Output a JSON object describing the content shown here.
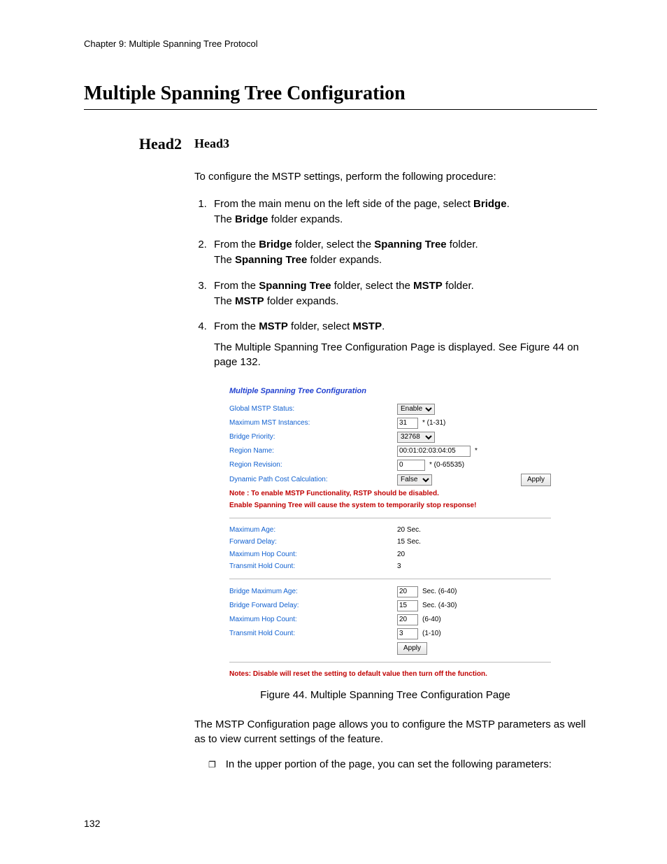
{
  "chapter_line": "Chapter 9: Multiple Spanning Tree Protocol",
  "h1": "Multiple Spanning Tree Configuration",
  "head2": "Head2",
  "head3": "Head3",
  "intro": "To configure the MSTP settings, perform the following procedure:",
  "steps": {
    "s1_a": "From the main menu on the left side of the page, select ",
    "s1_bold": "Bridge",
    "s1_b": ".",
    "s1_sub_a": "The ",
    "s1_sub_bold": "Bridge",
    "s1_sub_b": " folder expands.",
    "s2_a": "From the ",
    "s2_bold1": "Bridge",
    "s2_b": " folder, select the ",
    "s2_bold2": "Spanning Tree",
    "s2_c": " folder.",
    "s2_sub_a": "The ",
    "s2_sub_bold": "Spanning Tree",
    "s2_sub_b": " folder expands.",
    "s3_a": "From the ",
    "s3_bold1": "Spanning Tree",
    "s3_b": " folder, select the ",
    "s3_bold2": "MSTP",
    "s3_c": " folder.",
    "s3_sub_a": "The ",
    "s3_sub_bold": "MSTP",
    "s3_sub_b": " folder expands.",
    "s4_a": "From the ",
    "s4_bold1": "MSTP",
    "s4_b": " folder, select ",
    "s4_bold2": "MSTP",
    "s4_c": ".",
    "s4_note": "The Multiple Spanning Tree Configuration Page is displayed. See Figure 44 on page 132."
  },
  "ui": {
    "title": "Multiple Spanning Tree Configuration",
    "row1_label": "Global MSTP Status:",
    "row1_value": "Enable",
    "row2_label": "Maximum MST Instances:",
    "row2_value": "31",
    "row2_hint": "* (1-31)",
    "row3_label": "Bridge Priority:",
    "row3_value": "32768",
    "row4_label": "Region Name:",
    "row4_value": "00:01:02:03:04:05",
    "row4_hint": "*",
    "row5_label": "Region Revision:",
    "row5_value": "0",
    "row5_hint": "* (0-65535)",
    "row6_label": "Dynamic Path Cost Calculation:",
    "row6_value": "False",
    "apply1": "Apply",
    "note1": "Note : To enable MSTP Functionality, RSTP should be disabled.",
    "note2": "Enable Spanning Tree will cause the system to temporarily stop response!",
    "row7_label": "Maximum Age:",
    "row7_value": "20 Sec.",
    "row8_label": "Forward Delay:",
    "row8_value": "15 Sec.",
    "row9_label": "Maximum Hop Count:",
    "row9_value": "20",
    "row10_label": "Transmit Hold Count:",
    "row10_value": "3",
    "row11_label": "Bridge Maximum Age:",
    "row11_value": "20",
    "row11_hint": "Sec. (6-40)",
    "row12_label": "Bridge Forward Delay:",
    "row12_value": "15",
    "row12_hint": "Sec. (4-30)",
    "row13_label": "Maximum Hop Count:",
    "row13_value": "20",
    "row13_hint": "(6-40)",
    "row14_label": "Transmit Hold Count:",
    "row14_value": "3",
    "row14_hint": "(1-10)",
    "apply2": "Apply",
    "note3": "Notes: Disable will reset the setting to default value then turn off the function."
  },
  "figure_caption": "Figure 44. Multiple Spanning Tree Configuration Page",
  "after_fig": "The MSTP Configuration page allows you to configure the MSTP parameters as well as to view current settings of the feature.",
  "bullet": "In the upper portion of the page, you can set the following parameters:",
  "page_num": "132"
}
